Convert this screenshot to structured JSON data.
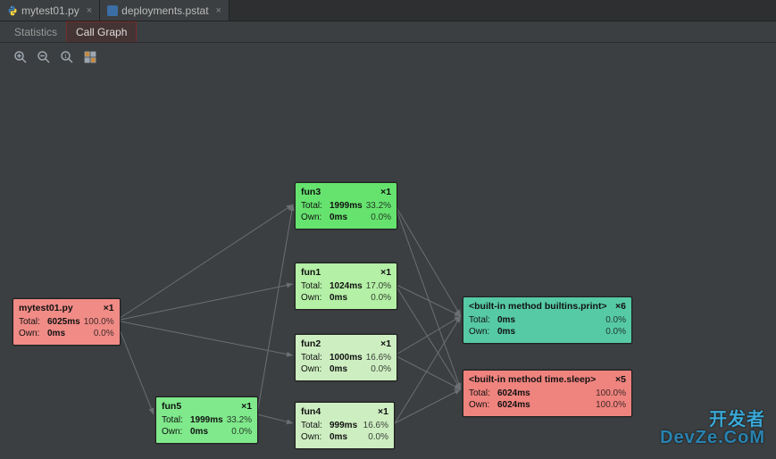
{
  "tabs": {
    "file1": "mytest01.py",
    "file2": "deployments.pstat"
  },
  "subtabs": {
    "stats": "Statistics",
    "callgraph": "Call Graph"
  },
  "nodes": {
    "root": {
      "title": "mytest01.py",
      "count": "×1",
      "total_lbl": "Total:",
      "total_v": "6025ms",
      "total_p": "100.0%",
      "own_lbl": "Own:",
      "own_v": "0ms",
      "own_p": "0.0%"
    },
    "fun3": {
      "title": "fun3",
      "count": "×1",
      "total_lbl": "Total:",
      "total_v": "1999ms",
      "total_p": "33.2%",
      "own_lbl": "Own:",
      "own_v": "0ms",
      "own_p": "0.0%"
    },
    "fun1": {
      "title": "fun1",
      "count": "×1",
      "total_lbl": "Total:",
      "total_v": "1024ms",
      "total_p": "17.0%",
      "own_lbl": "Own:",
      "own_v": "0ms",
      "own_p": "0.0%"
    },
    "fun2": {
      "title": "fun2",
      "count": "×1",
      "total_lbl": "Total:",
      "total_v": "1000ms",
      "total_p": "16.6%",
      "own_lbl": "Own:",
      "own_v": "0ms",
      "own_p": "0.0%"
    },
    "fun4": {
      "title": "fun4",
      "count": "×1",
      "total_lbl": "Total:",
      "total_v": "999ms",
      "total_p": "16.6%",
      "own_lbl": "Own:",
      "own_v": "0ms",
      "own_p": "0.0%"
    },
    "fun5": {
      "title": "fun5",
      "count": "×1",
      "total_lbl": "Total:",
      "total_v": "1999ms",
      "total_p": "33.2%",
      "own_lbl": "Own:",
      "own_v": "0ms",
      "own_p": "0.0%"
    },
    "print": {
      "title": "<built-in method builtins.print>",
      "count": "×6",
      "total_lbl": "Total:",
      "total_v": "0ms",
      "total_p": "0.0%",
      "own_lbl": "Own:",
      "own_v": "0ms",
      "own_p": "0.0%"
    },
    "sleep": {
      "title": "<built-in method time.sleep>",
      "count": "×5",
      "total_lbl": "Total:",
      "total_v": "6024ms",
      "total_p": "100.0%",
      "own_lbl": "Own:",
      "own_v": "6024ms",
      "own_p": "100.0%"
    }
  },
  "watermark": {
    "l1": "开发者",
    "l2": "DevZe.CoM"
  }
}
